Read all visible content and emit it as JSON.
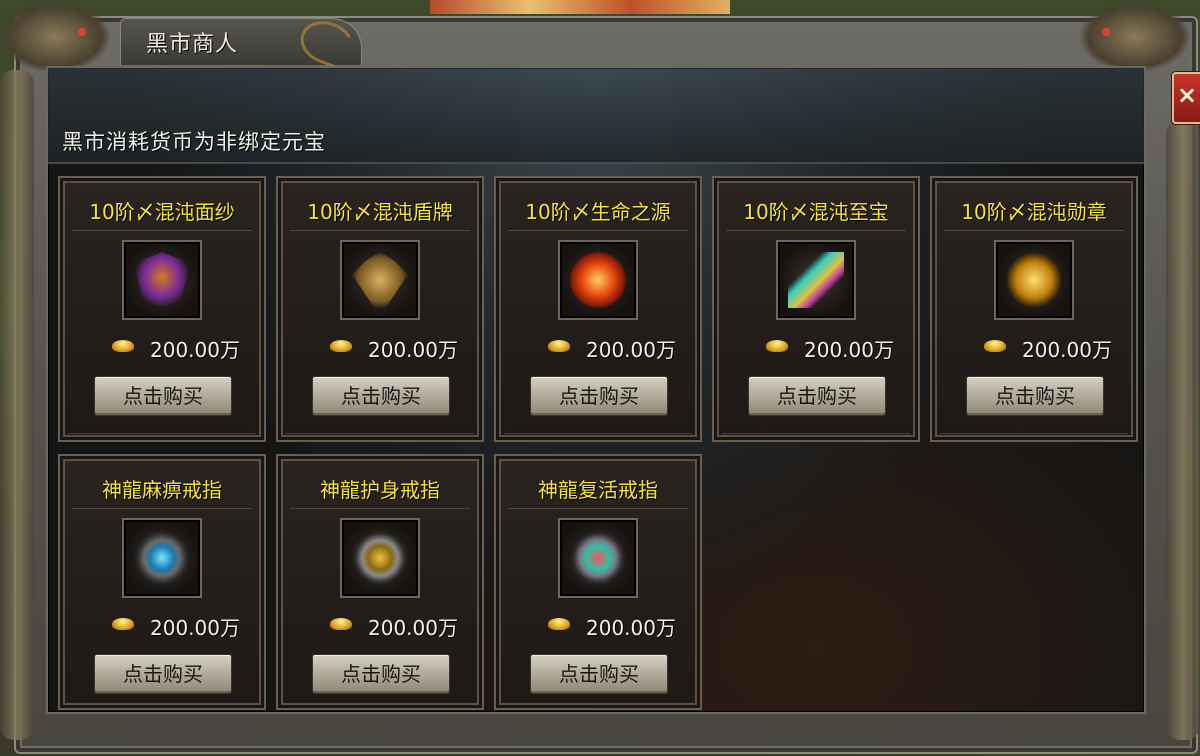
{
  "window": {
    "title": "黑市商人",
    "close_label": "×"
  },
  "notice": "黑市消耗货币为非绑定元宝",
  "currency_icon": "gold-ingot-icon",
  "items": [
    {
      "name": "10阶〆混沌面纱",
      "price": "200.00万",
      "buy_label": "点击购买",
      "icon": "mask-icon"
    },
    {
      "name": "10阶〆混沌盾牌",
      "price": "200.00万",
      "buy_label": "点击购买",
      "icon": "shield-icon"
    },
    {
      "name": "10阶〆生命之源",
      "price": "200.00万",
      "buy_label": "点击购买",
      "icon": "fire-orb-icon"
    },
    {
      "name": "10阶〆混沌至宝",
      "price": "200.00万",
      "buy_label": "点击购买",
      "icon": "dagger-icon"
    },
    {
      "name": "10阶〆混沌勋章",
      "price": "200.00万",
      "buy_label": "点击购买",
      "icon": "medal-icon"
    },
    {
      "name": "神龍麻痹戒指",
      "price": "200.00万",
      "buy_label": "点击购买",
      "icon": "blue-ring-icon"
    },
    {
      "name": "神龍护身戒指",
      "price": "200.00万",
      "buy_label": "点击购买",
      "icon": "gold-ring-icon"
    },
    {
      "name": "神龍复活戒指",
      "price": "200.00万",
      "buy_label": "点击购买",
      "icon": "red-ring-icon"
    }
  ]
}
